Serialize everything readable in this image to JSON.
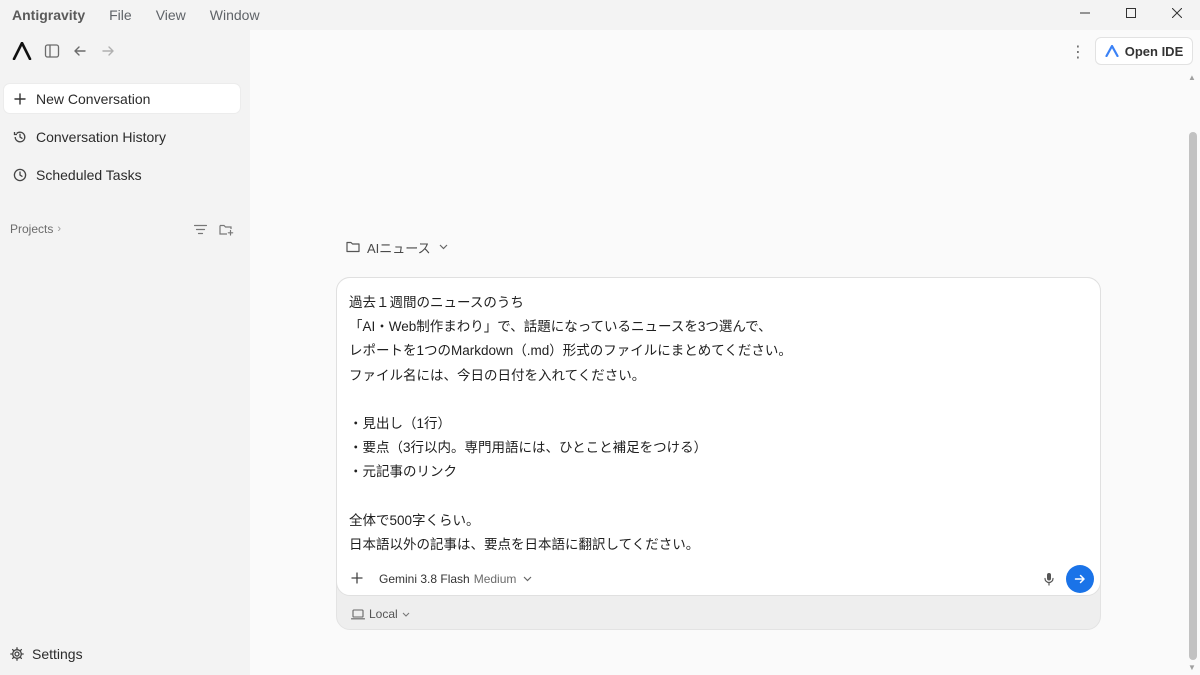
{
  "menubar": {
    "app_name": "Antigravity",
    "items": [
      "File",
      "View",
      "Window"
    ]
  },
  "window_controls": [
    "minimize-icon",
    "maximize-icon",
    "close-icon"
  ],
  "sidebar": {
    "nav": [
      {
        "label": "New Conversation",
        "icon": "plus-icon"
      },
      {
        "label": "Conversation History",
        "icon": "history-icon"
      },
      {
        "label": "Scheduled Tasks",
        "icon": "clock-icon"
      }
    ],
    "projects_label": "Projects",
    "settings_label": "Settings"
  },
  "header": {
    "open_ide_label": "Open IDE"
  },
  "composer": {
    "workspace": "AIニュース",
    "prompt_lines": [
      "過去１週間のニュースのうち",
      "「AI・Web制作まわり」で、話題になっているニュースを3つ選んで、",
      "レポートを1つのMarkdown（.md）形式のファイルにまとめてください。",
      "ファイル名には、今日の日付を入れてください。",
      "",
      "・見出し（1行）",
      "・要点（3行以内。専門用語には、ひとこと補足をつける）",
      "・元記事のリンク",
      "",
      "全体で500字くらい。",
      "日本語以外の記事は、要点を日本語に翻訳してください。"
    ],
    "model_name": "Gemini 3.8 Flash",
    "model_effort": "Medium",
    "environment": "Local"
  },
  "colors": {
    "accent": "#1a73e8",
    "sidebar_bg": "#f3f3f3",
    "main_bg": "#fafafa"
  }
}
